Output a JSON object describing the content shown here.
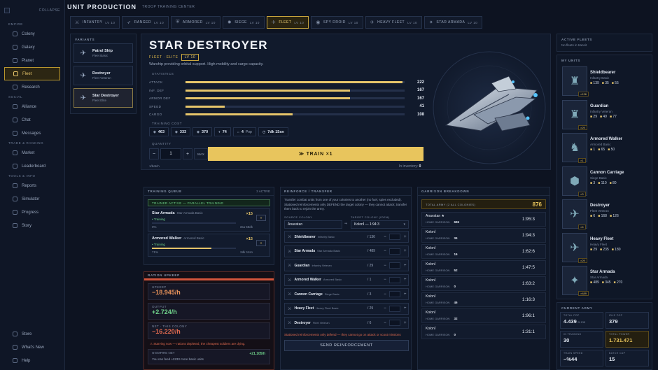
{
  "sidebar": {
    "collapse": "COLLAPSE",
    "sections": [
      {
        "title": "EMPIRE",
        "items": [
          {
            "label": "Colony",
            "icon": "home-icon"
          },
          {
            "label": "Galaxy",
            "icon": "galaxy-icon"
          },
          {
            "label": "Planet",
            "icon": "planet-icon"
          },
          {
            "label": "Fleet",
            "icon": "fleet-icon",
            "active": true
          },
          {
            "label": "Research",
            "icon": "flask-icon"
          }
        ]
      },
      {
        "title": "SOCIAL",
        "items": [
          {
            "label": "Alliance",
            "icon": "shield-icon"
          },
          {
            "label": "Chat",
            "icon": "chat-icon"
          },
          {
            "label": "Messages",
            "icon": "mail-icon"
          }
        ]
      },
      {
        "title": "TRADE & RANKING",
        "items": [
          {
            "label": "Market",
            "icon": "cart-icon"
          },
          {
            "label": "Leaderboard",
            "icon": "trophy-icon"
          }
        ]
      },
      {
        "title": "TOOLS & INFO",
        "items": [
          {
            "label": "Reports",
            "icon": "report-icon"
          },
          {
            "label": "Simulator",
            "icon": "sim-icon"
          },
          {
            "label": "Progress",
            "icon": "progress-icon"
          },
          {
            "label": "Story",
            "icon": "book-icon"
          }
        ]
      }
    ],
    "bottom": [
      {
        "label": "Store",
        "icon": "store-icon"
      },
      {
        "label": "What's New",
        "icon": "news-icon"
      },
      {
        "label": "Help",
        "icon": "help-icon"
      }
    ]
  },
  "header": {
    "title": "UNIT PRODUCTION",
    "subtitle": "TROOP TRAINING CENTER"
  },
  "tabs": [
    {
      "label": "INFANTRY",
      "lv": "LV 10",
      "icon": "⚔"
    },
    {
      "label": "RANGED",
      "lv": "LV 10",
      "icon": "➶"
    },
    {
      "label": "ARMORED",
      "lv": "LV 10",
      "icon": "⛨"
    },
    {
      "label": "SIEGE",
      "lv": "LV 10",
      "icon": "✹"
    },
    {
      "label": "FLEET",
      "lv": "LV 10",
      "icon": "✈",
      "active": true
    },
    {
      "label": "SPY DROID",
      "lv": "LV 10",
      "icon": "◉"
    },
    {
      "label": "HEAVY FLEET",
      "lv": "LV 10",
      "icon": "✈"
    },
    {
      "label": "STAR ARMADA",
      "lv": "LV 10",
      "icon": "✦"
    }
  ],
  "variants": {
    "title": "VARIANTS",
    "items": [
      {
        "name": "Patrol Ship",
        "sub": "Fleet Basic"
      },
      {
        "name": "Destroyer",
        "sub": "Fleet Veteran"
      },
      {
        "name": "Star Destroyer",
        "sub": "Fleet Elite",
        "active": true
      }
    ]
  },
  "unit": {
    "name": "STAR DESTROYER",
    "tag": "FLEET · ELITE",
    "lv": "LV 10",
    "description": "Warship providing orbital support. High mobility and cargo capacity.",
    "stats_title": "STATISTICS",
    "stats": [
      {
        "k": "ATTACK",
        "v": "222",
        "p": 0.99
      },
      {
        "k": "INF. DEF",
        "v": "167",
        "p": 0.75
      },
      {
        "k": "ARMOR DEF",
        "v": "167",
        "p": 0.75
      },
      {
        "k": "SPEED",
        "v": "41",
        "p": 0.18
      },
      {
        "k": "CARGO",
        "v": "108",
        "p": 0.49
      }
    ],
    "cost_title": "TRAINING COST",
    "costs": [
      {
        "icon": "◆",
        "v": "463"
      },
      {
        "icon": "◆",
        "v": "333"
      },
      {
        "icon": "◆",
        "v": "370"
      },
      {
        "icon": "♦",
        "v": "74"
      },
      {
        "icon": "⌂",
        "v": "4",
        "sm": "Pop"
      },
      {
        "icon": "◷",
        "v": "7dk 15sn"
      }
    ],
    "qty_title": "QUANTITY",
    "qty": "1",
    "minus": "−",
    "plus": "+",
    "max": "MAX",
    "train": "≫ TRAIN ×1",
    "per_batch": "1/batch",
    "inventory_label": "In inventory:",
    "inventory": "0"
  },
  "queue": {
    "title": "TRAINING QUEUE",
    "count": "2 ACTIVE",
    "active_label": "TRAINER ACTIVE — PARALLEL TRAINING",
    "items": [
      {
        "name": "Star Armada",
        "variant": "Star Armada Basic",
        "qty": "×15",
        "status": "• Training",
        "pct": "0%",
        "pval": 0,
        "time": "3sa 58dk"
      },
      {
        "name": "Armored Walker",
        "variant": "Armored Basic",
        "qty": "×15",
        "status": "• Training",
        "pct": "71%",
        "pval": 0.71,
        "time": "2dk 11sn"
      }
    ]
  },
  "upkeep": {
    "title": "RATION UPKEEP",
    "upkeep_label": "UPKEEP",
    "upkeep": "−18.945/h",
    "output_label": "OUTPUT",
    "output": "+2.724/h",
    "net_label": "NET · THIS COLONY",
    "net": "−16.220/h",
    "starving": "⚠ Starving now — rations depleted, the cheapest soldiers are dying.",
    "empire_label": "⊕ EMPIRE NET",
    "empire_val": "+21.105/h",
    "empire_desc": "You can feed ≈2233 more basic units"
  },
  "reinforce": {
    "title": "REINFORCE / TRANSFER",
    "desc": "Transfer combat units from one of your colonies to another (no fuel, spies excluded). Stationed reinforcements only DEFEND the target colony — they cannot attack; transfer them back to rejoin the army.",
    "source_label": "SOURCE COLONY",
    "target_label": "TARGET COLONY (IDEM)",
    "source": "Anavatan",
    "arrow": "⇒",
    "target": "Kolonİ — 1:94:3",
    "rows": [
      {
        "name": "Shieldbearer",
        "variant": "Infantry Basic",
        "count": "/ 136"
      },
      {
        "name": "Star Armada",
        "variant": "Star Armada Basic",
        "count": "/ 489"
      },
      {
        "name": "Guardian",
        "variant": "Infantry Veteran",
        "count": "/ 29"
      },
      {
        "name": "Armored Walker",
        "variant": "Armored Basic",
        "count": "/ 1"
      },
      {
        "name": "Cannon Carriage",
        "variant": "Siege Basic",
        "count": "/ 3"
      },
      {
        "name": "Heavy Fleet",
        "variant": "Heavy Fleet Basic",
        "count": "/ 29"
      },
      {
        "name": "Destroyer",
        "variant": "Fleet Veteran",
        "count": "/ 6"
      }
    ],
    "minus": "−",
    "plus": "+",
    "warning": "Stationed reinforcements only defend — they cannot go on attack or scout missions",
    "send": "SEND REINFORCEMENT"
  },
  "garrison": {
    "title": "GARRISON BREAKDOWN",
    "total_label": "TOTAL ARMY (2 ALL COLONIES)",
    "total": "876",
    "hg": "HOME GARRISON",
    "rows": [
      {
        "name": "Anavatan ★",
        "count": "696",
        "coord": "1:95:3"
      },
      {
        "name": "Kolonİ",
        "count": "34",
        "coord": "1:94:3"
      },
      {
        "name": "Kolonİ",
        "count": "16",
        "coord": "1:62:6"
      },
      {
        "name": "Kolonİ",
        "count": "52",
        "coord": "1:47:5"
      },
      {
        "name": "Kolonİ",
        "count": "0",
        "coord": "1:63:2"
      },
      {
        "name": "Kolonİ",
        "count": "46",
        "coord": "1:16:3"
      },
      {
        "name": "Kolonİ",
        "count": "32",
        "coord": "1:96:1"
      },
      {
        "name": "Kolonİ",
        "count": "0",
        "coord": "1:31:1"
      }
    ]
  },
  "fleets": {
    "title": "ACTIVE FLEETS",
    "empty": "No fleets in transit"
  },
  "my_units": {
    "title": "MY UNITS",
    "items": [
      {
        "name": "Shieldbearer",
        "sub": "Infantry Basic",
        "count": "×136",
        "a": "139",
        "b": "35",
        "c": "55",
        "glyph": "♜"
      },
      {
        "name": "Guardian",
        "sub": "Infantry Veteran",
        "count": "×29",
        "a": "29",
        "b": "49",
        "c": "77",
        "glyph": "♜"
      },
      {
        "name": "Armored Walker",
        "sub": "Armored Basic",
        "count": "×1",
        "a": "1",
        "b": "65",
        "c": "50",
        "glyph": "♞"
      },
      {
        "name": "Cannon Carriage",
        "sub": "Siege Basic",
        "count": "×3",
        "a": "3",
        "b": "110",
        "c": "80",
        "glyph": "⬢"
      },
      {
        "name": "Destroyer",
        "sub": "Fleet Veteran",
        "count": "×6",
        "a": "6",
        "b": "168",
        "c": "126",
        "glyph": "✈"
      },
      {
        "name": "Heavy Fleet",
        "sub": "Heavy Fleet",
        "count": "×29",
        "a": "29",
        "b": "235",
        "c": "180",
        "glyph": "✈"
      },
      {
        "name": "Star Armada",
        "sub": "Star Armada",
        "count": "×489",
        "a": "489",
        "b": "345",
        "c": "270",
        "glyph": "✦"
      }
    ]
  },
  "army": {
    "title": "CURRENT ARMY",
    "boxes": [
      {
        "l": "TOTAL POP",
        "v": "4.439",
        "s": "/ 5.135"
      },
      {
        "l": "IDLE POP",
        "v": "379",
        "s": ""
      },
      {
        "l": "IN TRAINING",
        "v": "30",
        "s": ""
      },
      {
        "l": "TOTAL POWER",
        "v": "1.731.471",
        "s": "",
        "gold": true
      },
      {
        "l": "TRAIN SPEED",
        "v": "−%44",
        "s": ""
      },
      {
        "l": "BATCH CAP",
        "v": "15",
        "s": ""
      }
    ]
  },
  "colors": {
    "accent": "#e8c55d",
    "green": "#6fd18a",
    "red": "#e06a4f",
    "bg": "#0d1321"
  }
}
